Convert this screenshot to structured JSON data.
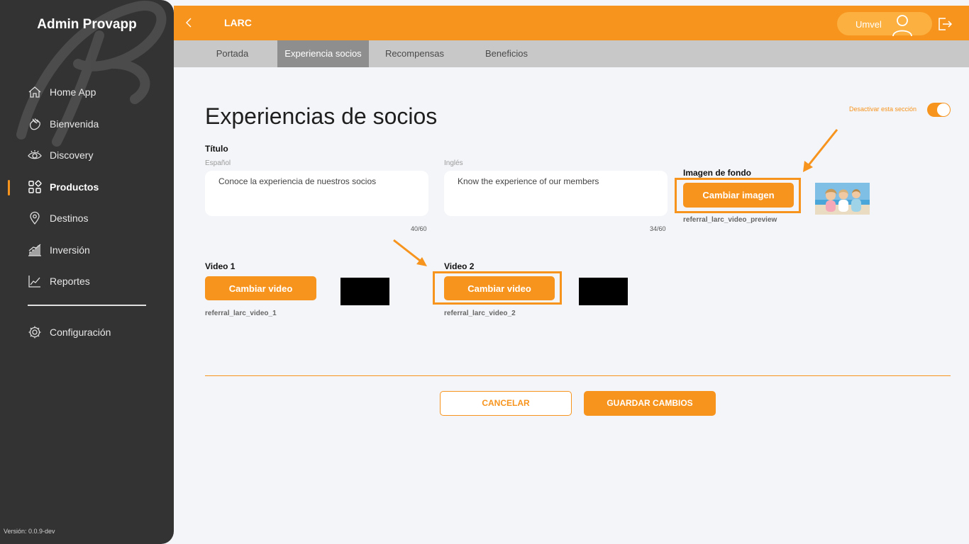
{
  "sidebar": {
    "brand": "Admin Provapp",
    "items": [
      {
        "label": "Home App",
        "icon": "home-icon"
      },
      {
        "label": "Bienvenida",
        "icon": "wave-hand-icon"
      },
      {
        "label": "Discovery",
        "icon": "eye-icon"
      },
      {
        "label": "Productos",
        "icon": "grid-icon",
        "active": true
      },
      {
        "label": "Destinos",
        "icon": "map-pin-icon"
      },
      {
        "label": "Inversión",
        "icon": "bar-chart-icon"
      },
      {
        "label": "Reportes",
        "icon": "line-chart-icon"
      }
    ],
    "config_label": "Configuración",
    "version": "Versión: 0.0.9-dev"
  },
  "header": {
    "title": "LARC",
    "user_name": "Umvel"
  },
  "tabs": [
    {
      "label": "Portada"
    },
    {
      "label": "Experiencia socios",
      "active": true
    },
    {
      "label": "Recompensas"
    },
    {
      "label": "Beneficios"
    }
  ],
  "main": {
    "title": "Experiencias de socios",
    "toggle_label": "Desactivar esta sección",
    "titulo_label": "Título",
    "spanish_label": "Español",
    "english_label": "Inglés",
    "spanish_value": "Conoce la experiencia de nuestros socios",
    "english_value": "Know the experience of our members",
    "spanish_counter": "40/60",
    "english_counter": "34/60",
    "background": {
      "label": "Imagen de fondo",
      "button": "Cambiar imagen",
      "filename": "referral_larc_video_preview"
    },
    "video1": {
      "label": "Video 1",
      "button": "Cambiar video",
      "filename": "referral_larc_video_1"
    },
    "video2": {
      "label": "Video 2",
      "button": "Cambiar video",
      "filename": "referral_larc_video_2"
    },
    "cancel": "CANCELAR",
    "save": "GUARDAR CAMBIOS"
  },
  "colors": {
    "accent": "#f7941d",
    "sidebar": "#333333",
    "tabs_bg": "#c8c8c8",
    "tab_active": "#8e8e8e"
  }
}
